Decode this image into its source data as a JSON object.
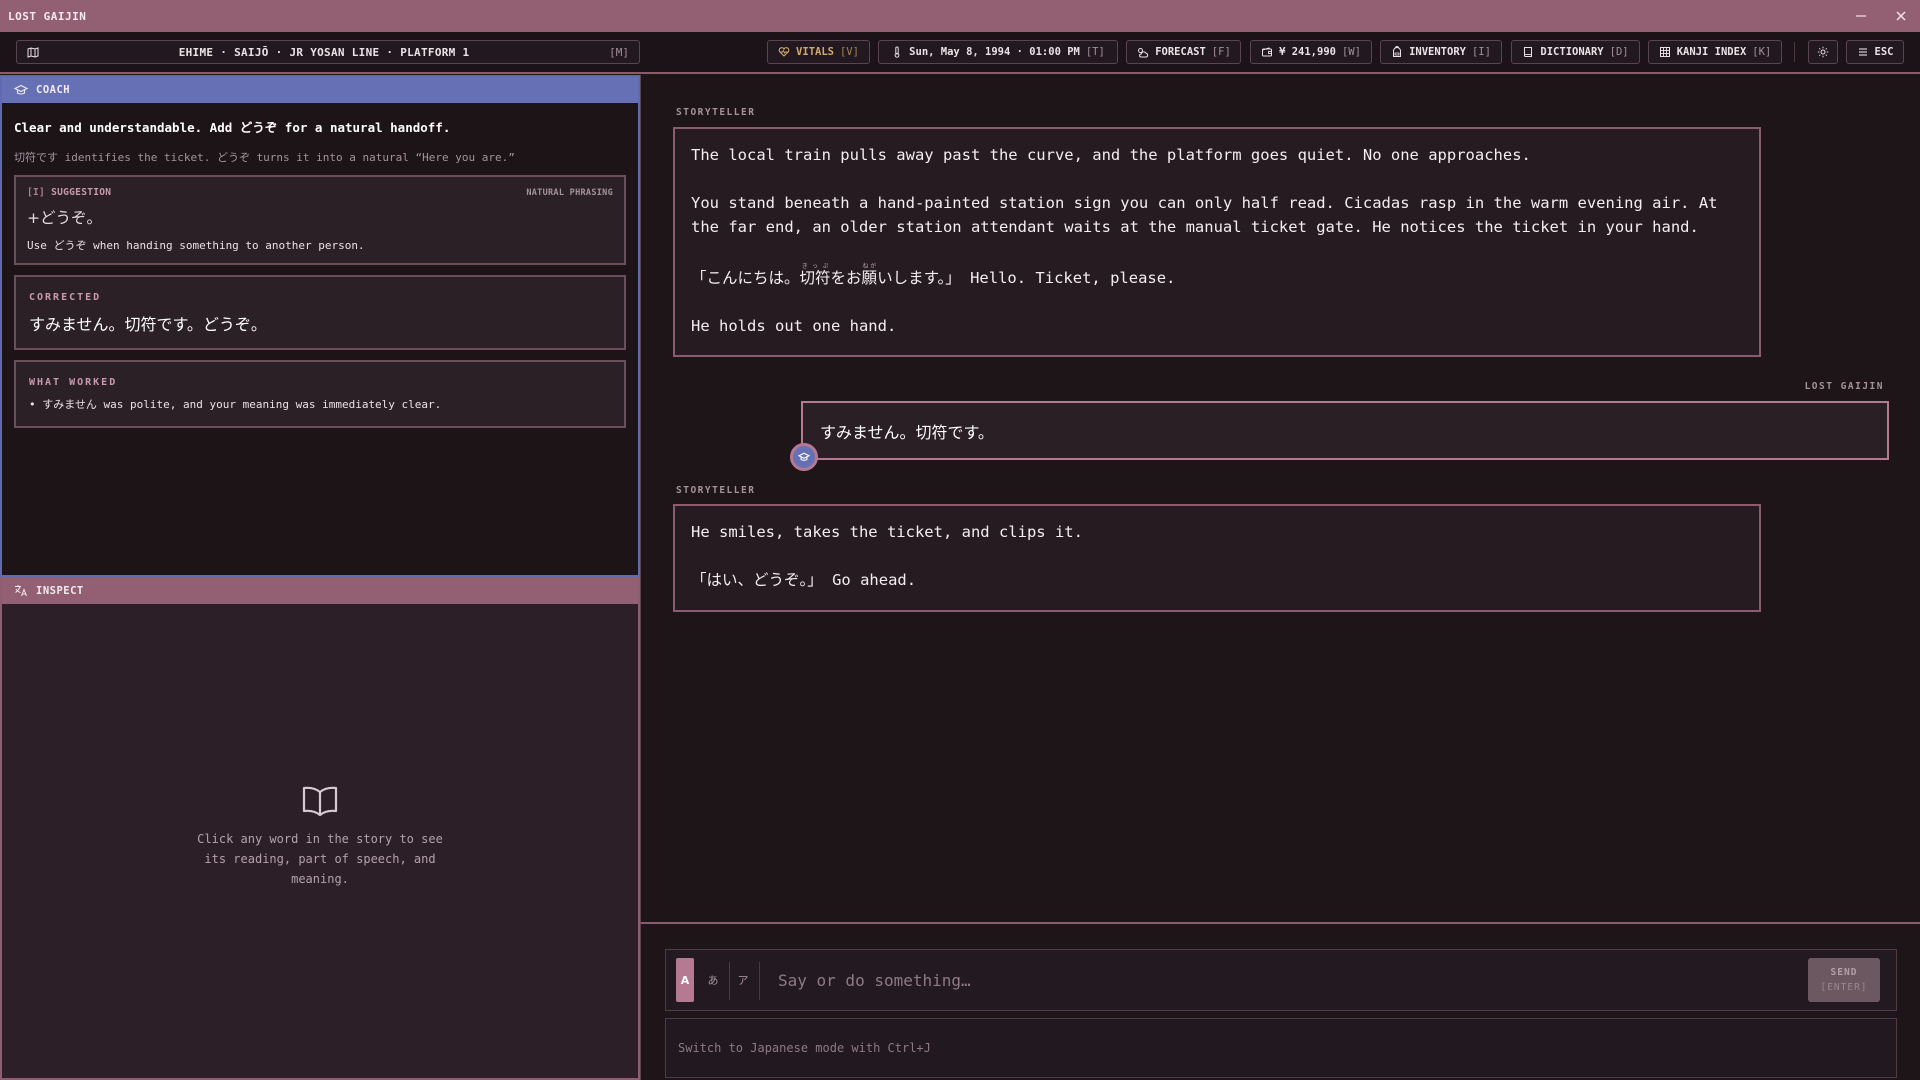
{
  "window": {
    "title": "LOST GAIJIN"
  },
  "topbar": {
    "location": "EHIME · SAIJŌ · JR YOSAN LINE · PLATFORM 1",
    "location_key": "[M]",
    "vitals": {
      "label": "VITALS",
      "key": "[V]"
    },
    "datetime": {
      "label": "Sun, May 8, 1994 · 01:00 PM",
      "key": "[T]"
    },
    "forecast": {
      "label": "FORECAST",
      "key": "[F]"
    },
    "wallet": {
      "label": "¥ 241,990",
      "key": "[W]"
    },
    "inventory": {
      "label": "INVENTORY",
      "key": "[I]"
    },
    "dictionary": {
      "label": "DICTIONARY",
      "key": "[D]"
    },
    "kanji_index": {
      "label": "KANJI INDEX",
      "key": "[K]"
    },
    "menu": {
      "label": "ESC"
    }
  },
  "coach": {
    "title": "COACH",
    "headline": "Clear and understandable. Add どうぞ for a natural handoff.",
    "subtext": "切符です identifies the ticket. どうぞ turns it into a natural “Here you are.”",
    "suggestion": {
      "key": "[I]",
      "tag": "SUGGESTION",
      "category": "NATURAL PHRASING",
      "text": "+どうぞ。",
      "note": "Use どうぞ when handing something to another person."
    },
    "corrected": {
      "label": "CORRECTED",
      "text": "すみません。切符です。どうぞ。"
    },
    "what_worked": {
      "label": "WHAT WORKED",
      "items": [
        "• すみません was polite, and your meaning was immediately clear."
      ]
    }
  },
  "inspect": {
    "title": "INSPECT",
    "hint": "Click any word in the story to see its reading, part of speech, and meaning."
  },
  "story": {
    "messages": [
      {
        "speaker": "STORYTELLER",
        "paragraphs": [
          "The local train pulls away past the curve, and the platform goes quiet. No one approaches.",
          "You stand beneath a hand-painted station sign you can only half read. Cicadas rasp in the warm evening air. At the far end, an older station attendant waits at the manual ticket gate. He notices the ticket in your hand."
        ],
        "dialogue": {
          "open": "「こんにちは。",
          "kanji1": "切符",
          "reading1": "きっぷ",
          "mid": "をお",
          "kanji2": "願",
          "reading2": "ねが",
          "close": "いします。」",
          "translation": " Hello. Ticket, please."
        },
        "closing": "He holds out one hand."
      },
      {
        "speaker": "LOST GAIJIN",
        "text": "すみません。切符です。"
      },
      {
        "speaker": "STORYTELLER",
        "paragraphs": [
          "He smiles, takes the ticket, and clips it."
        ],
        "dialogue_jp": "「はい、どうぞ。」",
        "dialogue_en": " Go ahead."
      }
    ]
  },
  "composer": {
    "modes": [
      "A",
      "あ",
      "ア"
    ],
    "placeholder": "Say or do something…",
    "send_label": "SEND",
    "send_key": "[ENTER]",
    "hint": "Switch to Japanese mode with Ctrl+J"
  },
  "colors": {
    "accent": "#935f73",
    "coach_accent": "#6670b4",
    "vitals": "#d4a76a",
    "background": "#1e1519"
  },
  "icons": [
    "map-icon",
    "vitals-icon",
    "thermometer-icon",
    "weather-icon",
    "wallet-icon",
    "backpack-icon",
    "book-icon",
    "grid-icon",
    "sun-icon",
    "menu-icon",
    "graduation-cap-icon",
    "translate-icon",
    "open-book-icon"
  ]
}
